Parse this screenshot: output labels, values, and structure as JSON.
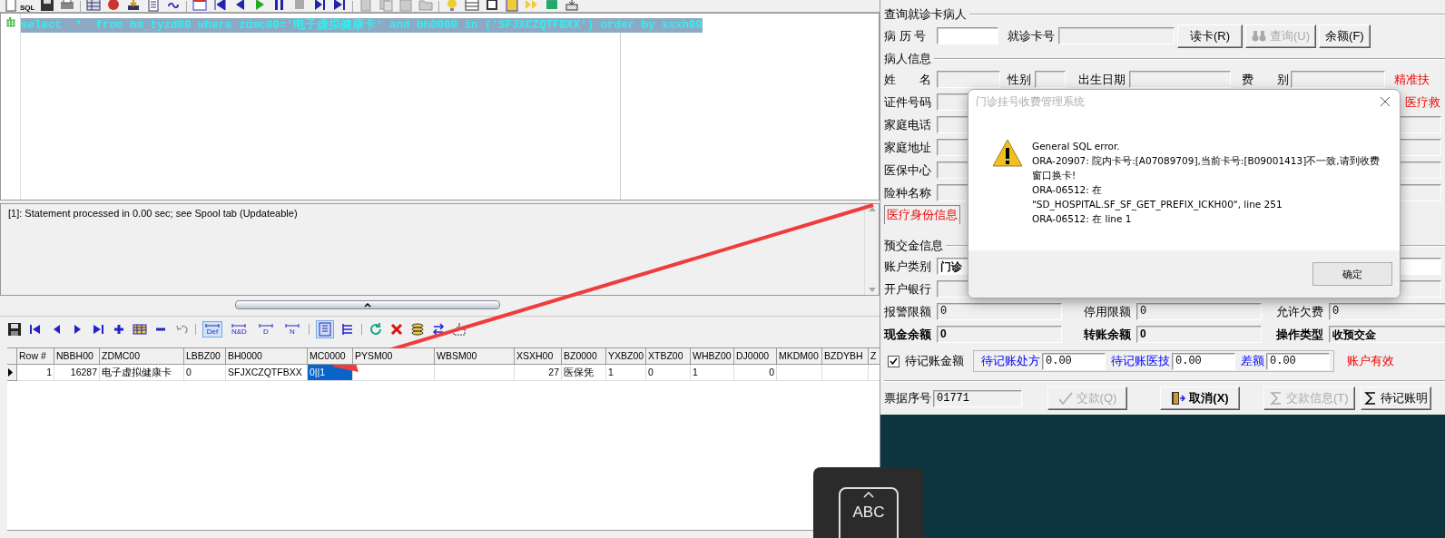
{
  "main_toolbar": {
    "sql_label": "SQL"
  },
  "editor": {
    "query": "select  *  from bm_tyzd00 where zdmc00='电子虚拟健康卡' and bh0000 in ('SFJXCZQTFBXX') order by xsxh00"
  },
  "messages": [
    "[1]: Statement processed in 0.00 sec; see Spool tab (Updateable)"
  ],
  "grid_toolbar": {
    "filters": [
      {
        "label": "Def",
        "selected": true
      },
      {
        "label": "N&D",
        "selected": false
      },
      {
        "label": "D",
        "selected": false
      },
      {
        "label": "N",
        "selected": false
      }
    ]
  },
  "grid": {
    "columns": [
      {
        "label": "Row #"
      },
      {
        "label": "NBBH00"
      },
      {
        "label": "ZDMC00"
      },
      {
        "label": "LBBZ00"
      },
      {
        "label": "BH0000"
      },
      {
        "label": "MC0000"
      },
      {
        "label": "PYSM00"
      },
      {
        "label": "WBSM00"
      },
      {
        "label": "XSXH00"
      },
      {
        "label": "BZ0000"
      },
      {
        "label": "YXBZ00"
      },
      {
        "label": "XTBZ00"
      },
      {
        "label": "WHBZ00"
      },
      {
        "label": "DJ0000"
      },
      {
        "label": "MKDM00"
      },
      {
        "label": "BZDYBH"
      },
      {
        "label": "Z"
      }
    ],
    "rows": [
      {
        "current": true,
        "cells": [
          {
            "text": "1",
            "selected": false
          },
          {
            "text": "16287",
            "selected": false
          },
          {
            "text": "电子虚拟健康卡",
            "selected": false
          },
          {
            "text": "0",
            "selected": false
          },
          {
            "text": "SFJXCZQTFBXX",
            "selected": false
          },
          {
            "text": "0||1",
            "selected": true
          },
          {
            "selected": false
          },
          {
            "selected": false
          },
          {
            "text": "27",
            "selected": false
          },
          {
            "text": "医保凭",
            "selected": false
          },
          {
            "text": "1",
            "selected": false
          },
          {
            "text": "0",
            "selected": false
          },
          {
            "text": "1",
            "selected": false
          },
          {
            "text": "0",
            "selected": false
          },
          {
            "selected": false
          },
          {
            "selected": false
          },
          {
            "selected": false
          }
        ]
      }
    ]
  },
  "patient_query": {
    "title": "查询就诊卡病人",
    "record_no": {
      "label": "病 历 号",
      "editable": true
    },
    "card_no": {
      "label": "就诊卡号",
      "editable": false
    },
    "buttons": [
      {
        "label": "读卡(R)",
        "kind": "plain",
        "disabled": false
      },
      {
        "label": "查询(U)",
        "kind": "search",
        "disabled": true
      },
      {
        "label": "余额(F)",
        "kind": "plain",
        "disabled": false
      }
    ]
  },
  "patient_info": {
    "title": "病人信息",
    "name_row": [
      {
        "label": "姓　　名"
      },
      {
        "label": "性别"
      },
      {
        "label": "出生日期"
      },
      {
        "label": "费　　别"
      }
    ],
    "flags": [
      "精准扶",
      "医疗救"
    ],
    "fields": [
      {
        "label": "证件号码"
      },
      {
        "label": "家庭电话"
      },
      {
        "label": "家庭地址"
      },
      {
        "label": "医保中心"
      },
      {
        "label": "险种名称"
      }
    ],
    "tabs": [
      {
        "label": "医疗身份信息",
        "selected": true
      }
    ]
  },
  "deposit": {
    "title": "预交金信息",
    "account_type": {
      "label": "账户类别",
      "value": "门诊"
    },
    "bank": {
      "label": "开户银行"
    },
    "limits": [
      {
        "label": "报警限额",
        "value": "0"
      },
      {
        "label": "停用限额",
        "value": "0"
      },
      {
        "label": "允许欠费",
        "value": "0"
      }
    ],
    "balances": [
      {
        "label": "现金余额",
        "value": "0"
      },
      {
        "label": "转账余额",
        "value": "0"
      },
      {
        "label": "操作类型",
        "value": "收预交金"
      }
    ],
    "pending": {
      "label": "待记账金额",
      "checked": true,
      "items": [
        {
          "label": "待记账处方",
          "value": "0.00"
        },
        {
          "label": "待记账医技",
          "value": "0.00"
        },
        {
          "label": "差额",
          "value": "0.00"
        }
      ],
      "status": "账户有效"
    }
  },
  "footer": {
    "receipt": {
      "label": "票据序号",
      "value": "01771"
    },
    "buttons": [
      {
        "label": "交款(Q)",
        "kind": "check",
        "disabled": true
      },
      {
        "label": "取消(X)",
        "kind": "exit",
        "disabled": false
      },
      {
        "label": "交款信息(T)",
        "kind": "sigma",
        "disabled": true
      },
      {
        "label": "待记账明",
        "kind": "sigma",
        "disabled": false
      }
    ]
  },
  "dialog": {
    "title": "门诊挂号收费管理系统",
    "lines": [
      "General SQL error.",
      "ORA-20907: 院内卡号:[A07089709],当前卡号:[B09001413]不一致,请到收费",
      "窗口换卡!",
      "ORA-06512: 在",
      "\"SD_HOSPITAL.SF_SF_GET_PREFIX_ICKH00\", line 251",
      "ORA-06512: 在 line 1"
    ],
    "ok": "确定"
  },
  "ime": {
    "label": "ABC"
  }
}
